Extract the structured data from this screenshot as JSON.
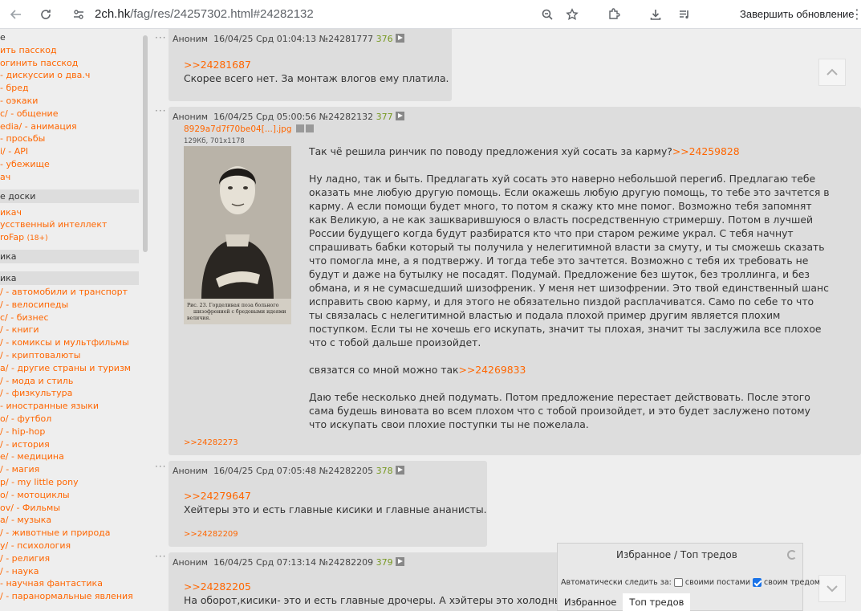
{
  "browser": {
    "url_host": "2ch.hk",
    "url_path": "/fag/res/24257302.html#24282132",
    "update_button": "Завершить обновление",
    "icons": [
      "back-arrow-icon",
      "reload-icon",
      "site-settings-icon",
      "zoom-icon",
      "star-icon",
      "extensions-icon",
      "download-icon",
      "media-icon",
      "kebab-menu-icon"
    ]
  },
  "sidebar": {
    "top_items": [
      {
        "label": "е",
        "dark": true
      },
      {
        "label": "ить пасскод"
      },
      {
        "label": "огинить пасскод"
      },
      {
        "label": " - дискуссии о два.ч"
      },
      {
        "label": "- бред"
      },
      {
        "label": "- оэкаки"
      },
      {
        "label": "c/ - общение"
      },
      {
        "label": "edia/ - анимация"
      },
      {
        "label": " - просьбы"
      },
      {
        "label": "i/ - API"
      },
      {
        "label": " - убежище"
      },
      {
        "label": "ач"
      }
    ],
    "section_other": "е доски",
    "other_items": [
      {
        "label": "икач"
      },
      {
        "label": "усственный интеллект"
      },
      {
        "label": "roFap",
        "badge": "(18+)"
      }
    ],
    "section_politics": "ика",
    "section_thematic": "ика",
    "thematic_items": [
      {
        "label": "/ - автомобили и транспорт"
      },
      {
        "label": "/ - велосипеды"
      },
      {
        "label": "c/ - бизнес"
      },
      {
        "label": "/ - книги"
      },
      {
        "label": "/ - комиксы и мультфильмы"
      },
      {
        "label": "/ - криптовалюты"
      },
      {
        "label": "a/ - другие страны и туризм"
      },
      {
        "label": "/ - мода и стиль"
      },
      {
        "label": "/ - физкультура"
      },
      {
        "label": " - иностранные языки"
      },
      {
        "label": "o/ - футбол"
      },
      {
        "label": "/ - hip-hop"
      },
      {
        "label": "/ - история"
      },
      {
        "label": "e/ - медицина"
      },
      {
        "label": "/ - магия"
      },
      {
        "label": "p/ - my little pony"
      },
      {
        "label": "o/ - мотоциклы"
      },
      {
        "label": "ov/ - Фильмы"
      },
      {
        "label": "a/ - музыка"
      },
      {
        "label": "/ - животные и природа"
      },
      {
        "label": "y/ - психология"
      },
      {
        "label": "/ - религия"
      },
      {
        "label": "/ - наука"
      },
      {
        "label": "- научная фантастика"
      },
      {
        "label": "/ - паранормальные явления"
      }
    ]
  },
  "posts": [
    {
      "header": {
        "name": "Аноним",
        "date": "16/04/25 Срд 01:04:13",
        "id": "№24281777",
        "num": "376"
      },
      "reply": ">>24281687",
      "text": "Скорее всего нет. За монтаж влогов ему платила."
    },
    {
      "header": {
        "name": "Аноним",
        "date": "16/04/25 Срд 05:00:56",
        "id": "№24282132",
        "num": "377"
      },
      "file_name": "8929a7d7f70be04[...].jpg",
      "file_meta": "129Кб, 701x1178",
      "thumb_caption": "Рис. 23. Горделивая поза больного шизофренией с бредовыми идеями величия.",
      "p1": "Так чё решила ринчик по поводу предложения хуй сосать за карму?",
      "p1_link": ">>24259828",
      "p2": "Ну ладно, так и быть. Предлагать хуй сосать это наверно небольшой перегиб. Предлагаю тебе оказать мне любую другую помощь. Если окажешь любую другую помощь, то тебе это зачтется в карму. А если помощи будет много, то потом я скажу кто мне помог. Возможно тебя запомнят как Великую, а не как зашкварившуюся о власть посредственную стримершу. Потом в лучшей России будущего когда будут разбиратся кто что при старом режиме украл. С тебя начнут спрашивать бабки который ты получила у нелегитимной власти за смуту, и ты сможешь сказать что помогла мне, а я подтвержу. И тогда тебе это зачтется. Возможно с тебя их требовать не будут и даже на бутылку не посадят. Подумай. Предложение без шуток, без троллинга, и без обмана, и я не сумасшедший шизофреник. У меня нет шизофрении. Это твой единственный шанс исправить свою карму, и для этого не обязательно пиздой расплачиватся. Само по себе то что ты связалась с нелегитимной властью и подала плохой пример другим является плохим поступком. Если ты не хочешь его искупать, значит ты плохая, значит ты заслужила все плохое что с тобой дальше произойдет.",
      "p3": "связатся со мной можно так",
      "p3_link": ">>24269833",
      "p4": "Даю тебе несколько дней подумать. Потом предложение перестает действовать. После этого сама будешь виновата во всем плохом что с тобой произойдет, и это будет заслужено потому что искупать свои плохие поступки ты не пожелала.",
      "backlinks": ">>24282273"
    },
    {
      "header": {
        "name": "Аноним",
        "date": "16/04/25 Срд 07:05:48",
        "id": "№24282205",
        "num": "378"
      },
      "reply": ">>24279647",
      "text": "Хейтеры это и есть главные кисики и главные ананисты.",
      "backlinks": ">>24282209"
    },
    {
      "header": {
        "name": "Аноним",
        "date": "16/04/25 Срд 07:13:14",
        "id": "№24282209",
        "num": "379"
      },
      "reply": ">>24282205",
      "text": "На оборот,кисики- это и есть главные дрочеры. А хэйтеры это холодные"
    }
  ],
  "favorites": {
    "title": "Избранное / Топ тредов",
    "auto_label": "Автоматически следить за:",
    "opt_own_posts": "своими постами",
    "opt_own_thread": "своим тредом",
    "tab_favorites": "Избранное",
    "tab_top": "Топ тредов"
  },
  "dots": "···",
  "colors": {
    "link": "#ff6600",
    "post_bg": "#dddddd",
    "page_bg": "#eeeeee",
    "post_num": "#789922"
  }
}
